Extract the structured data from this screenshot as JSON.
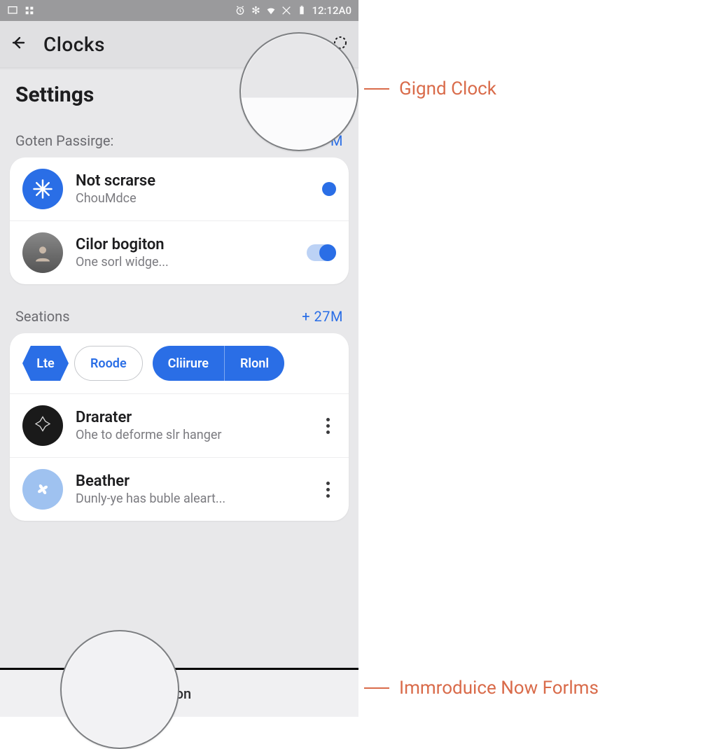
{
  "status": {
    "time": "12:12A0",
    "icons": [
      "window-icon",
      "grid-icon",
      "alarm-icon",
      "ring-icon",
      "wifi-icon",
      "signal-off-icon",
      "battery-icon"
    ]
  },
  "appbar": {
    "title": "Clocks"
  },
  "heading": "Settings",
  "section1": {
    "label": "Goten Passirge:",
    "right_hint": "M",
    "items": [
      {
        "title": "Not scrarse",
        "sub": "ChouMdce",
        "icon": "snowflake-icon",
        "tail": "radio"
      },
      {
        "title": "Cilor bogiton",
        "sub": "One sorl widge...",
        "icon": "avatar-icon",
        "tail": "toggle"
      }
    ]
  },
  "section2": {
    "label": "Seations",
    "right_hint": "+ 27M",
    "chips": {
      "hex": "Lte",
      "outline": "Roode",
      "solid_left": "Cliirure",
      "solid_right": "Rlonl"
    },
    "items": [
      {
        "title": "Drarater",
        "sub": "Ohe to deforme slr hanger",
        "icon": "gem-icon"
      },
      {
        "title": "Beather",
        "sub": "Dunly-ye has buble aleart...",
        "icon": "propeller-icon"
      }
    ]
  },
  "bottom": {
    "label": "tion"
  },
  "annotations": {
    "a1": "Gignd Clock",
    "a2": "Immroduice Now Forlms"
  },
  "colors": {
    "accent": "#2a6ee6",
    "annotation": "#d96b4a"
  }
}
